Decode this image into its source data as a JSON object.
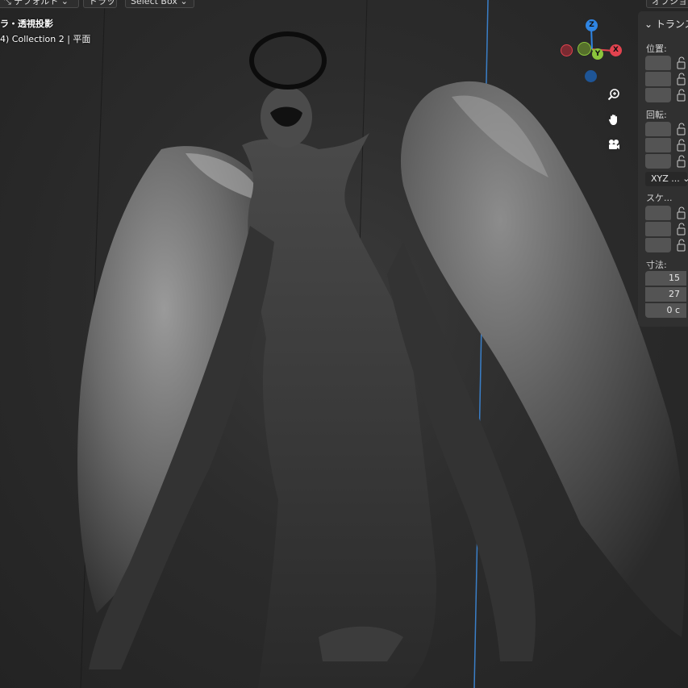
{
  "header": {
    "orientation_label": "デフォルト",
    "drag_label": "ドラッ...",
    "select_mode": "Select Box",
    "options_label": "オプショ"
  },
  "viewport": {
    "view_name": "ラ・透視投影",
    "collection_info": "4) Collection 2 | 平面"
  },
  "gizmo": {
    "z": "Z",
    "y": "Y",
    "x": "X",
    "colors": {
      "x": "#e2434f",
      "y": "#8bc43c",
      "z": "#2f85e3"
    }
  },
  "nav": {
    "zoom_icon": "zoom-icon",
    "pan_icon": "hand-icon",
    "camera_icon": "camera-icon"
  },
  "npanel": {
    "title": "トランス",
    "location_label": "位置:",
    "rotation_label": "回転:",
    "rotation_mode": "XYZ ...",
    "scale_label": "スケ...",
    "dimensions_label": "寸法:",
    "dimensions": [
      "15",
      "27",
      "0 c"
    ]
  }
}
